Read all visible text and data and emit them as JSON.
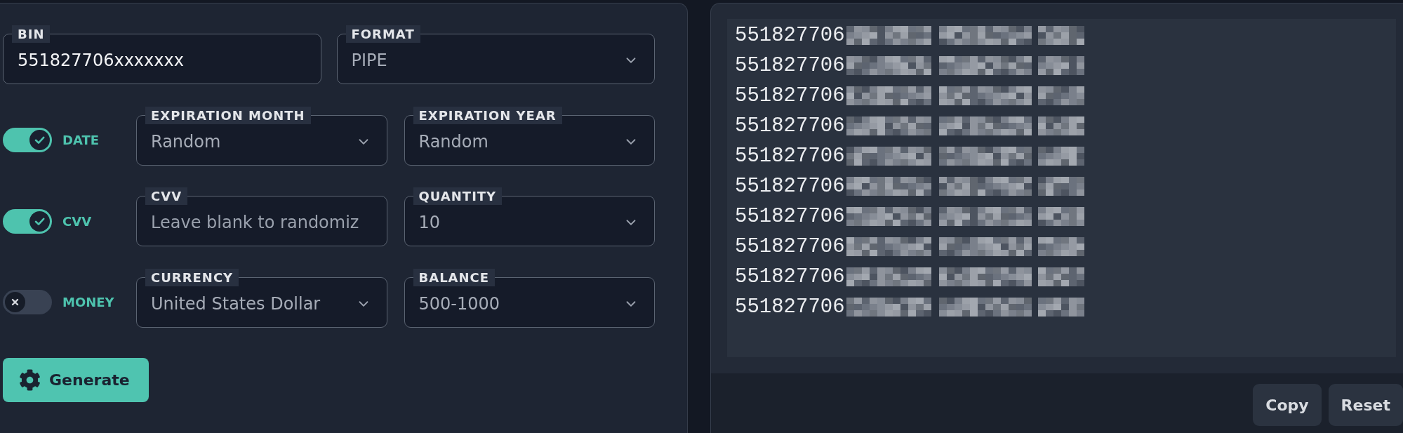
{
  "form": {
    "top_fields": [
      {
        "kind": "input",
        "label": "BIN",
        "value": "551827706xxxxxxx"
      },
      {
        "kind": "select",
        "label": "FORMAT",
        "value": "PIPE"
      }
    ],
    "rows": [
      {
        "toggle": {
          "label": "DATE",
          "on": true
        },
        "fields": [
          {
            "kind": "select",
            "label": "EXPIRATION MONTH",
            "value": "Random"
          },
          {
            "kind": "select",
            "label": "EXPIRATION YEAR",
            "value": "Random"
          }
        ]
      },
      {
        "toggle": {
          "label": "CVV",
          "on": true
        },
        "fields": [
          {
            "kind": "input",
            "label": "CVV",
            "placeholder": "Leave blank to randomiz"
          },
          {
            "kind": "select",
            "label": "QUANTITY",
            "value": "10"
          }
        ]
      },
      {
        "toggle": {
          "label": "MONEY",
          "on": false
        },
        "fields": [
          {
            "kind": "select",
            "label": "CURRENCY",
            "value": "United States Dollar"
          },
          {
            "kind": "select",
            "label": "BALANCE",
            "value": "500-1000"
          }
        ]
      }
    ],
    "generate_button": "Generate"
  },
  "output": {
    "lines": [
      {
        "text": "551827706",
        "redacted": true
      },
      {
        "text": "551827706",
        "redacted": true
      },
      {
        "text": "551827706",
        "redacted": true
      },
      {
        "text": "551827706",
        "redacted": true
      },
      {
        "text": "551827706",
        "redacted": true
      },
      {
        "text": "551827706",
        "redacted": true
      },
      {
        "text": "551827706",
        "redacted": true
      },
      {
        "text": "551827706",
        "redacted": true
      },
      {
        "text": "551827706",
        "redacted": true
      },
      {
        "text": "551827706",
        "redacted": true
      }
    ],
    "buttons": [
      "Copy",
      "Reset"
    ]
  }
}
